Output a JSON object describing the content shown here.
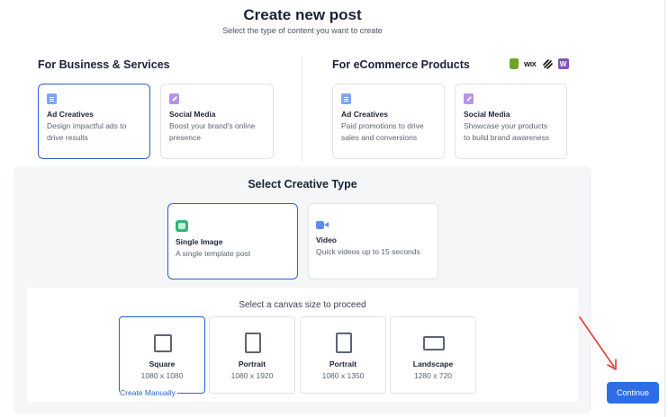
{
  "header": {
    "title": "Create new post",
    "subtitle": "Select the type of content you want to create"
  },
  "business": {
    "heading": "For Business & Services",
    "cards": [
      {
        "title": "Ad Creatives",
        "desc_line1": "Design impactful ads to",
        "desc_line2": "drive results",
        "icon": "document-icon",
        "selected": true
      },
      {
        "title": "Social Media",
        "desc_line1": "Boost your brand's online",
        "desc_line2": "presence",
        "icon": "pen-icon",
        "selected": false
      }
    ]
  },
  "ecommerce": {
    "heading": "For eCommerce Products",
    "logos": {
      "wix": "WIX",
      "woo": "W"
    },
    "cards": [
      {
        "title": "Ad Creatives",
        "desc_line1": "Paid promotions to drive",
        "desc_line2": "sales and conversions",
        "icon": "document-icon",
        "selected": false
      },
      {
        "title": "Social Media",
        "desc_line1": "Showcase your products",
        "desc_line2": "to build brand awareness",
        "icon": "pen-icon",
        "selected": false
      }
    ]
  },
  "creative_type": {
    "heading": "Select Creative Type",
    "options": [
      {
        "title": "Single Image",
        "desc": "A single template post",
        "icon": "image-icon",
        "selected": true
      },
      {
        "title": "Video",
        "desc": "Quick videos up to 15 seconds",
        "icon": "video-icon",
        "selected": false
      }
    ]
  },
  "canvas": {
    "prompt": "Select a canvas size to proceed",
    "sizes": [
      {
        "title": "Square",
        "dims": "1080 x 1080",
        "selected": true
      },
      {
        "title": "Portrait",
        "dims": "1080 x 1920",
        "selected": false
      },
      {
        "title": "Portrait",
        "dims": "1080 x 1350",
        "selected": false
      },
      {
        "title": "Landscape",
        "dims": "1280 x 720",
        "selected": false
      }
    ],
    "create_manually": "Create Manually"
  },
  "actions": {
    "continue_label": "Continue"
  },
  "colors": {
    "accent": "#2c5fd6",
    "button": "#2d6ee6",
    "annotation_arrow": "#e53935"
  }
}
